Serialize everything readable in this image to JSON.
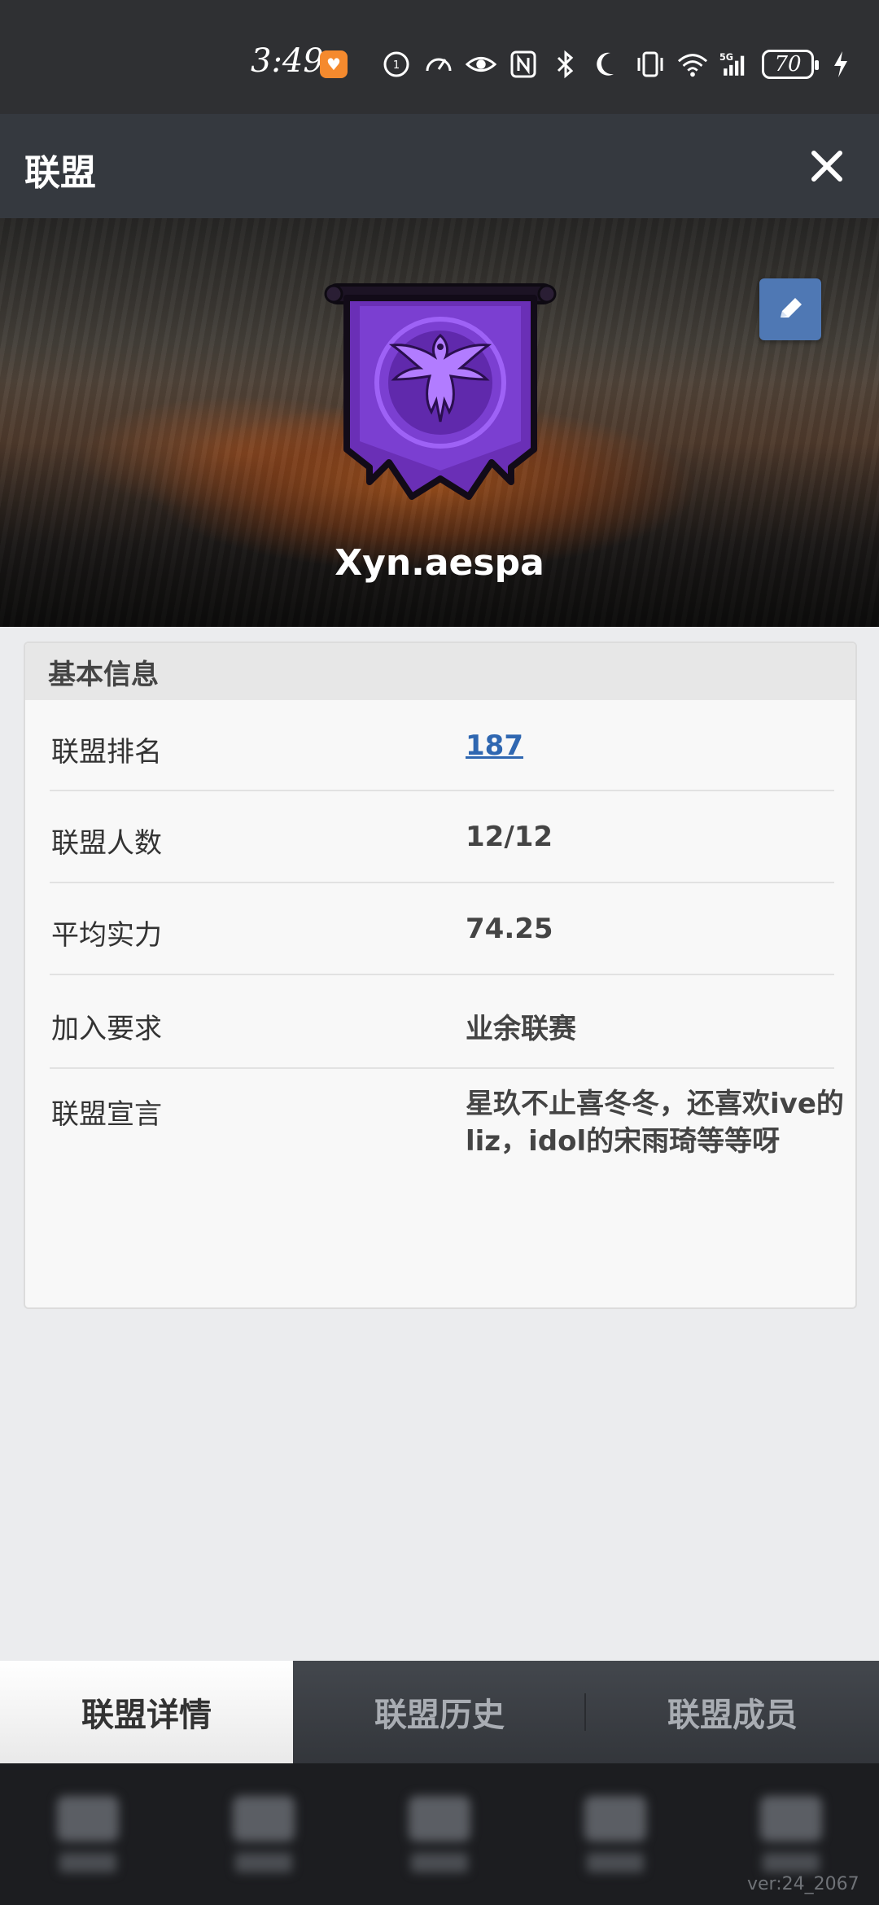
{
  "status_bar": {
    "time": "3:49",
    "battery": "70",
    "network": "5G",
    "icons": [
      "app-badge-icon",
      "data-saver-icon",
      "speedometer-icon",
      "eye-icon",
      "nfc-icon",
      "bluetooth-icon",
      "moon-icon",
      "vibrate-icon",
      "wifi-icon",
      "signal-icon",
      "charging-icon"
    ]
  },
  "header": {
    "title": "联盟",
    "close_icon": "close-icon"
  },
  "banner": {
    "team_name": "Xyn.aespa",
    "emblem": "phoenix-banner-emblem",
    "edit_icon": "pencil-icon"
  },
  "info": {
    "section_title": "基本信息",
    "rows": [
      {
        "label": "联盟排名",
        "value": "187"
      },
      {
        "label": "联盟人数",
        "value": "12/12"
      },
      {
        "label": "平均实力",
        "value": "74.25"
      },
      {
        "label": "加入要求",
        "value": "业余联赛"
      },
      {
        "label": "联盟宣言",
        "value": "星玖不止喜冬冬，还喜欢ive的liz，idol的宋雨琦等等呀"
      }
    ]
  },
  "tabs": [
    {
      "label": "联盟详情",
      "active": true
    },
    {
      "label": "联盟历史",
      "active": false
    },
    {
      "label": "联盟成员",
      "active": false
    }
  ],
  "footer": {
    "version": "ver:24_2067"
  },
  "colors": {
    "header_bg": "#35393f",
    "link": "#2f67b1",
    "edit_button": "#4f78b4",
    "emblem_purple": "#7b3fd1"
  }
}
